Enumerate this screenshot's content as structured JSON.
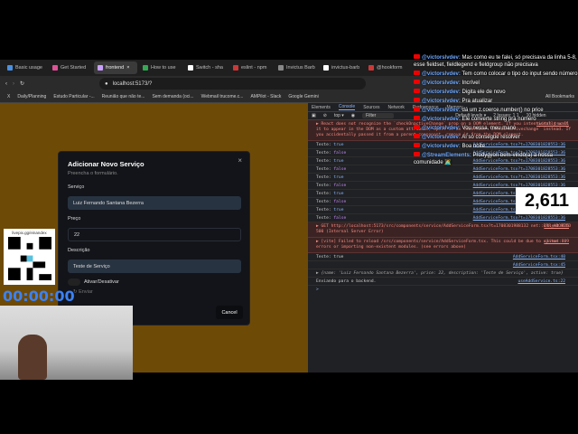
{
  "browser": {
    "tabs": [
      {
        "label": "Basic usage",
        "color": "#4a90e2"
      },
      {
        "label": "Get Started",
        "color": "#e05297"
      },
      {
        "label": "frontend",
        "color": "#c9a0ff",
        "active": true
      },
      {
        "label": "How to use",
        "color": "#34a853"
      },
      {
        "label": "Switch - sha",
        "color": "#ffffff"
      },
      {
        "label": "eslint - npm",
        "color": "#cb3837"
      },
      {
        "label": "Invictus Barb",
        "color": "#888888"
      },
      {
        "label": "invictus-barb",
        "color": "#ffffff"
      },
      {
        "label": "@hookform",
        "color": "#cb3837"
      }
    ],
    "close_tab": "×",
    "url": "localhost:5173/?",
    "bookmarks": [
      "X",
      "Daily/Planning",
      "Estudo Particular -...",
      "Reunião que não te...",
      "Sem demanda (oci...",
      "Webmail trucome.c...",
      "AMPilot - Slack",
      "Google Gemini"
    ],
    "all_bookmarks": "All Bookmarks"
  },
  "modal": {
    "title": "Adicionar Novo Serviço",
    "subtitle": "Preencha o formulário.",
    "close": "×",
    "service_label": "Serviço",
    "service_value": "Luiz Fernando Santana Bezerra",
    "price_label": "Preço",
    "price_value": "22",
    "desc_label": "Descrição",
    "desc_value": "Teste de Serviço",
    "toggle_label": "Ativar/Desativar",
    "submit": "Enviar",
    "cancel": "Cancel"
  },
  "devtools": {
    "tabs": [
      "Elements",
      "Console",
      "Sources",
      "Network",
      "Performance",
      "Memory"
    ],
    "active_tab": "Console",
    "context": "top ▾",
    "filter": "Filter",
    "levels": "Default levels ▾",
    "issues": "2 Issues: 1 1",
    "hidden": "10 hidden",
    "errors": "3",
    "warnings": "1",
    "err1": "▶ React does not recognize the `checkOnactiveChange` prop on a DOM element. If you intentionally want it to appear in the DOM as a custom attribute, spell it as lowercase `checkonactivechange` instead. If you accidentally passed it from a parent component, remove it from the DOM element.",
    "err1_src": "switch.tsx:11",
    "logs": [
      {
        "k": "Teste:",
        "v": "true"
      },
      {
        "k": "Teste:",
        "v": "false"
      },
      {
        "k": "Teste:",
        "v": "true"
      },
      {
        "k": "Teste:",
        "v": "false"
      },
      {
        "k": "Teste:",
        "v": "true"
      },
      {
        "k": "Teste:",
        "v": "false"
      },
      {
        "k": "Teste:",
        "v": "true"
      },
      {
        "k": "Teste:",
        "v": "false"
      },
      {
        "k": "Teste:",
        "v": "true"
      },
      {
        "k": "Teste:",
        "v": "false"
      }
    ],
    "log_src": "AddServiceForm.tsx?t=1708301828553:36",
    "err2": "▶ GET http://localhost:5173/src/components/service/AddServiceForm.tsx?t=1708301988132 net::ERR_ABORTED 500 (Internal Server Error)",
    "err2_src": "client:825",
    "err3": "▶ [vite] Failed to reload /src/components/service/AddServiceForm.tsx. This could be due to syntax errors or importing non-existent modules. (see errors above)",
    "err3_src": "client:809",
    "log_a": "Teste: true",
    "log_a_src": "AddServiceForm.tsx:40",
    "log_b_src": "AddServiceForm.tsx:45",
    "obj": "▶ {name: 'Luiz Fernando Santana Bezerra', price: 22, description: 'Teste de Serviço', active: true}",
    "send": "Enviando para o backend.",
    "send_src": "useAddService.ts:22",
    "prompt": ">"
  },
  "chat": [
    {
      "user": "@victorslvdev:",
      "text": "Mas como eu te falei, só precisava da linha 5-8, esse fieldset, fieldlegend e fieldgroup não precisava"
    },
    {
      "user": "@victorslvdev:",
      "text": "Tem como colocar o tipo do input sendo número"
    },
    {
      "user": "@victorslvdev:",
      "text": "Incrível"
    },
    {
      "user": "@victorslvdev:",
      "text": "Digita ele de novo"
    },
    {
      "user": "@victorslvdev:",
      "text": "Pra atualizar"
    },
    {
      "user": "@victorslvdev:",
      "text": "dá um z.coerce.number() no price"
    },
    {
      "user": "@victorslvdev:",
      "text": "Ele converte string pra número"
    },
    {
      "user": "@victorslvdev:",
      "text": "Vou nessa, meu mano"
    },
    {
      "user": "@victorslvdev:",
      "text": "Aí só consegue resolver"
    },
    {
      "user": "@victorslvdev:",
      "text": "Boa noite"
    },
    {
      "user": "@StreamElements:",
      "text": "Prodygyon bem-vindo(a) à nossa comunidade 🧑‍💻"
    }
  ],
  "overlay": {
    "counter": "2,611",
    "qr_url": "livepix.gg/einandex",
    "timer": "00:00:00"
  }
}
